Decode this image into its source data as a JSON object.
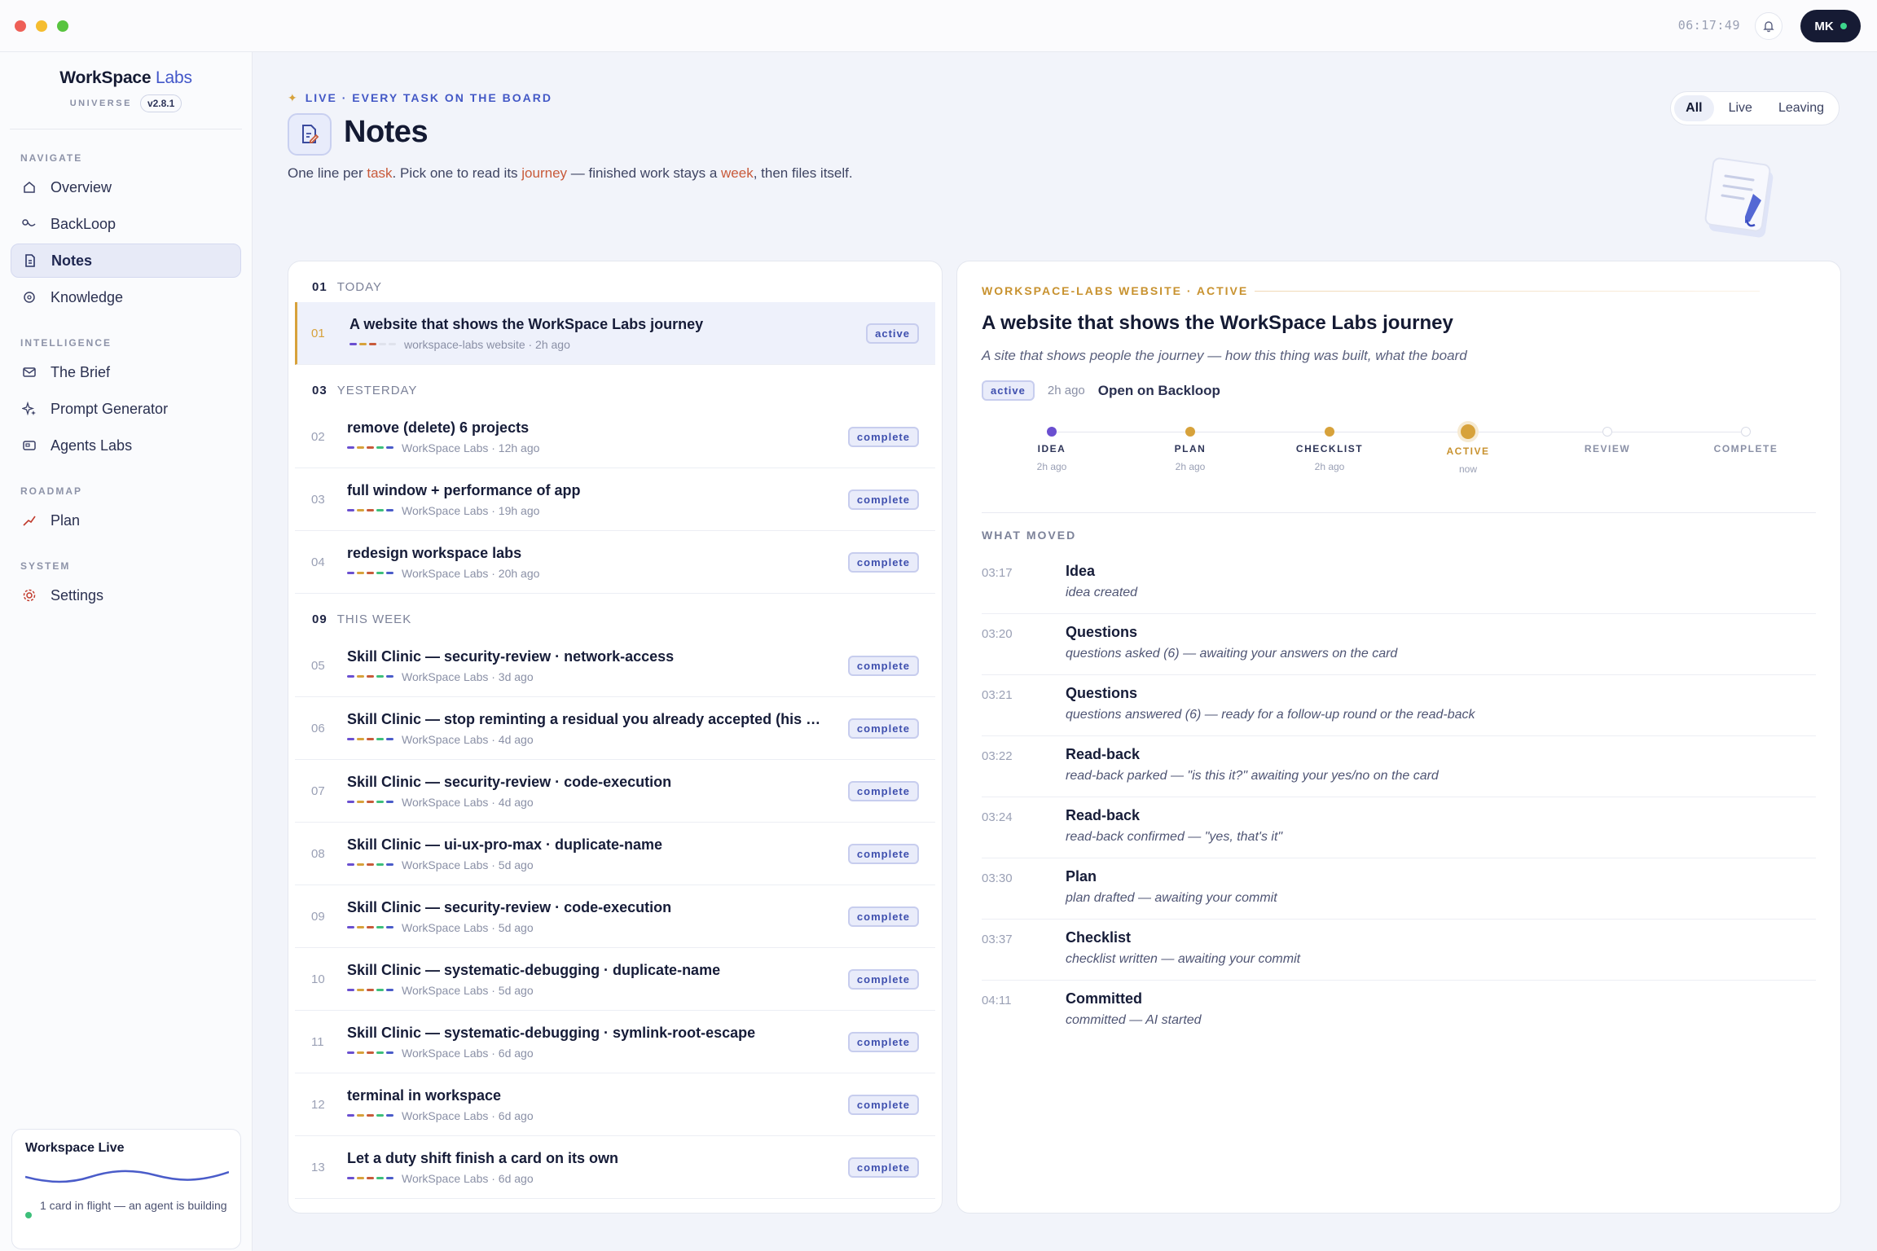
{
  "titlebar": {
    "clock": "06:17:49",
    "avatar_initials": "MK"
  },
  "brand": {
    "name": "WorkSpace",
    "accent": "Labs",
    "universe": "UNIVERSE",
    "version": "v2.8.1"
  },
  "nav": {
    "section_navigate": "NAVIGATE",
    "overview": "Overview",
    "backloop": "BackLoop",
    "notes": "Notes",
    "knowledge": "Knowledge",
    "section_intelligence": "INTELLIGENCE",
    "brief": "The Brief",
    "prompt_generator": "Prompt Generator",
    "agents_labs": "Agents Labs",
    "section_roadmap": "ROADMAP",
    "plan": "Plan",
    "section_system": "SYSTEM",
    "settings": "Settings"
  },
  "live_card": {
    "title": "Workspace Live",
    "status": "1 card in flight — an agent is building"
  },
  "header": {
    "eyebrow": "LIVE · EVERY TASK ON THE BOARD",
    "title": "Notes",
    "desc_1": "One line per ",
    "desc_task": "task",
    "desc_2": ". Pick one to read its ",
    "desc_journey": "journey",
    "desc_3": " — finished work stays a ",
    "desc_week": "week",
    "desc_4": ", then files itself."
  },
  "filter_tabs": {
    "all": "All",
    "live": "Live",
    "leaving": "Leaving"
  },
  "groups": {
    "today": {
      "num": "01",
      "label": "TODAY"
    },
    "yesterday": {
      "num": "03",
      "label": "YESTERDAY"
    },
    "this_week": {
      "num": "09",
      "label": "THIS WEEK"
    }
  },
  "rows": [
    {
      "num": "01",
      "title": "A website that shows the WorkSpace Labs journey",
      "meta": "workspace-labs website · 2h ago",
      "status": "active"
    },
    {
      "num": "02",
      "title": "remove (delete) 6 projects",
      "meta": "WorkSpace Labs · 12h ago",
      "status": "complete"
    },
    {
      "num": "03",
      "title": "full window + performance of app",
      "meta": "WorkSpace Labs · 19h ago",
      "status": "complete"
    },
    {
      "num": "04",
      "title": "redesign workspace labs",
      "meta": "WorkSpace Labs · 20h ago",
      "status": "complete"
    },
    {
      "num": "05",
      "title": "Skill Clinic — security-review · network-access",
      "meta": "WorkSpace Labs · 3d ago",
      "status": "complete"
    },
    {
      "num": "06",
      "title": "Skill Clinic — stop reminting a residual you already accepted (his ask, ...",
      "meta": "WorkSpace Labs · 4d ago",
      "status": "complete"
    },
    {
      "num": "07",
      "title": "Skill Clinic — security-review · code-execution",
      "meta": "WorkSpace Labs · 4d ago",
      "status": "complete"
    },
    {
      "num": "08",
      "title": "Skill Clinic — ui-ux-pro-max · duplicate-name",
      "meta": "WorkSpace Labs · 5d ago",
      "status": "complete"
    },
    {
      "num": "09",
      "title": "Skill Clinic — security-review · code-execution",
      "meta": "WorkSpace Labs · 5d ago",
      "status": "complete"
    },
    {
      "num": "10",
      "title": "Skill Clinic — systematic-debugging · duplicate-name",
      "meta": "WorkSpace Labs · 5d ago",
      "status": "complete"
    },
    {
      "num": "11",
      "title": "Skill Clinic — systematic-debugging · symlink-root-escape",
      "meta": "WorkSpace Labs · 6d ago",
      "status": "complete"
    },
    {
      "num": "12",
      "title": "terminal in workspace",
      "meta": "WorkSpace Labs · 6d ago",
      "status": "complete"
    },
    {
      "num": "13",
      "title": "Let a duty shift finish a card on its own",
      "meta": "WorkSpace Labs · 6d ago",
      "status": "complete"
    }
  ],
  "detail": {
    "eyebrow": "WORKSPACE-LABS WEBSITE · ACTIVE",
    "title": "A website that shows the WorkSpace Labs journey",
    "subtitle": "A site that shows people the journey — how this thing was built, what the board",
    "status": "active",
    "ago": "2h ago",
    "open_link": "Open on Backloop",
    "steps": [
      {
        "label": "IDEA",
        "time": "2h ago"
      },
      {
        "label": "PLAN",
        "time": "2h ago"
      },
      {
        "label": "CHECKLIST",
        "time": "2h ago"
      },
      {
        "label": "ACTIVE",
        "time": "now"
      },
      {
        "label": "REVIEW",
        "time": ""
      },
      {
        "label": "COMPLETE",
        "time": ""
      }
    ],
    "moved_head": "WHAT MOVED",
    "events": [
      {
        "time": "03:17",
        "title": "Idea",
        "desc": "idea created"
      },
      {
        "time": "03:20",
        "title": "Questions",
        "desc": "questions asked (6) — awaiting your answers on the card"
      },
      {
        "time": "03:21",
        "title": "Questions",
        "desc": "questions answered (6) — ready for a follow-up round or the read-back"
      },
      {
        "time": "03:22",
        "title": "Read-back",
        "desc": "read-back parked — \"is this it?\" awaiting your yes/no on the card"
      },
      {
        "time": "03:24",
        "title": "Read-back",
        "desc": "read-back confirmed — \"yes, that's it\""
      },
      {
        "time": "03:30",
        "title": "Plan",
        "desc": "plan drafted — awaiting your commit"
      },
      {
        "time": "03:37",
        "title": "Checklist",
        "desc": "checklist written — awaiting your commit"
      },
      {
        "time": "04:11",
        "title": "Committed",
        "desc": "committed — AI started"
      }
    ]
  },
  "colors": {
    "accent": "#4257c9",
    "gold": "#d7a23b",
    "purple": "#6a4fd0",
    "active_row": "#eef1fb"
  }
}
